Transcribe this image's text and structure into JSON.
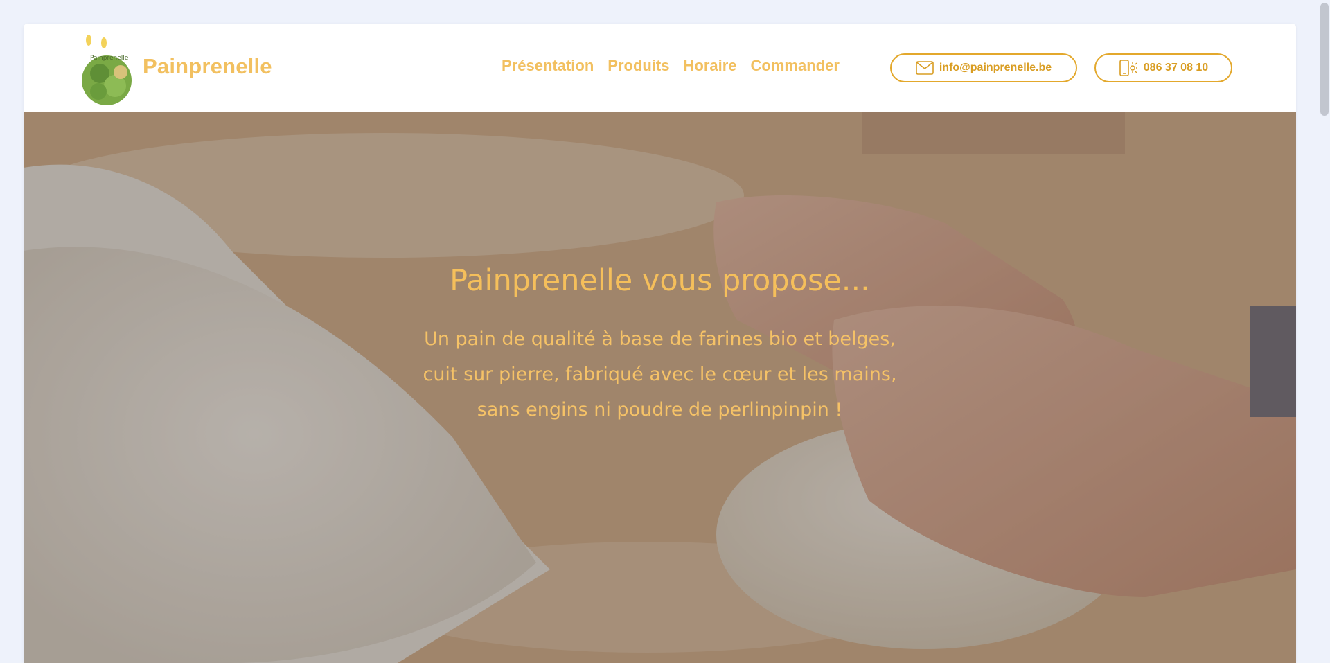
{
  "header": {
    "brand": "Painprenelle",
    "logo_text": "Painprenelle",
    "nav": [
      {
        "label": "Présentation"
      },
      {
        "label": "Produits"
      },
      {
        "label": "Horaire"
      },
      {
        "label": "Commander"
      }
    ],
    "email": {
      "label": "info@painprenelle.be",
      "icon": "envelope-icon"
    },
    "phone": {
      "label": "086 37 08 10",
      "icon": "mobile-phone-icon"
    }
  },
  "hero": {
    "title": "Painprenelle vous propose...",
    "lines": [
      "Un pain de qualité à base de farines bio et belges,",
      "cuit sur pierre, fabriqué avec le cœur et les mains,",
      "sans engins ni poudre de perlinpinpin !"
    ]
  },
  "colors": {
    "accent": "#f2c060",
    "accent_border": "#e3a82c",
    "hero_text": "#f5bf5b",
    "page_bg": "#eef2fb"
  }
}
